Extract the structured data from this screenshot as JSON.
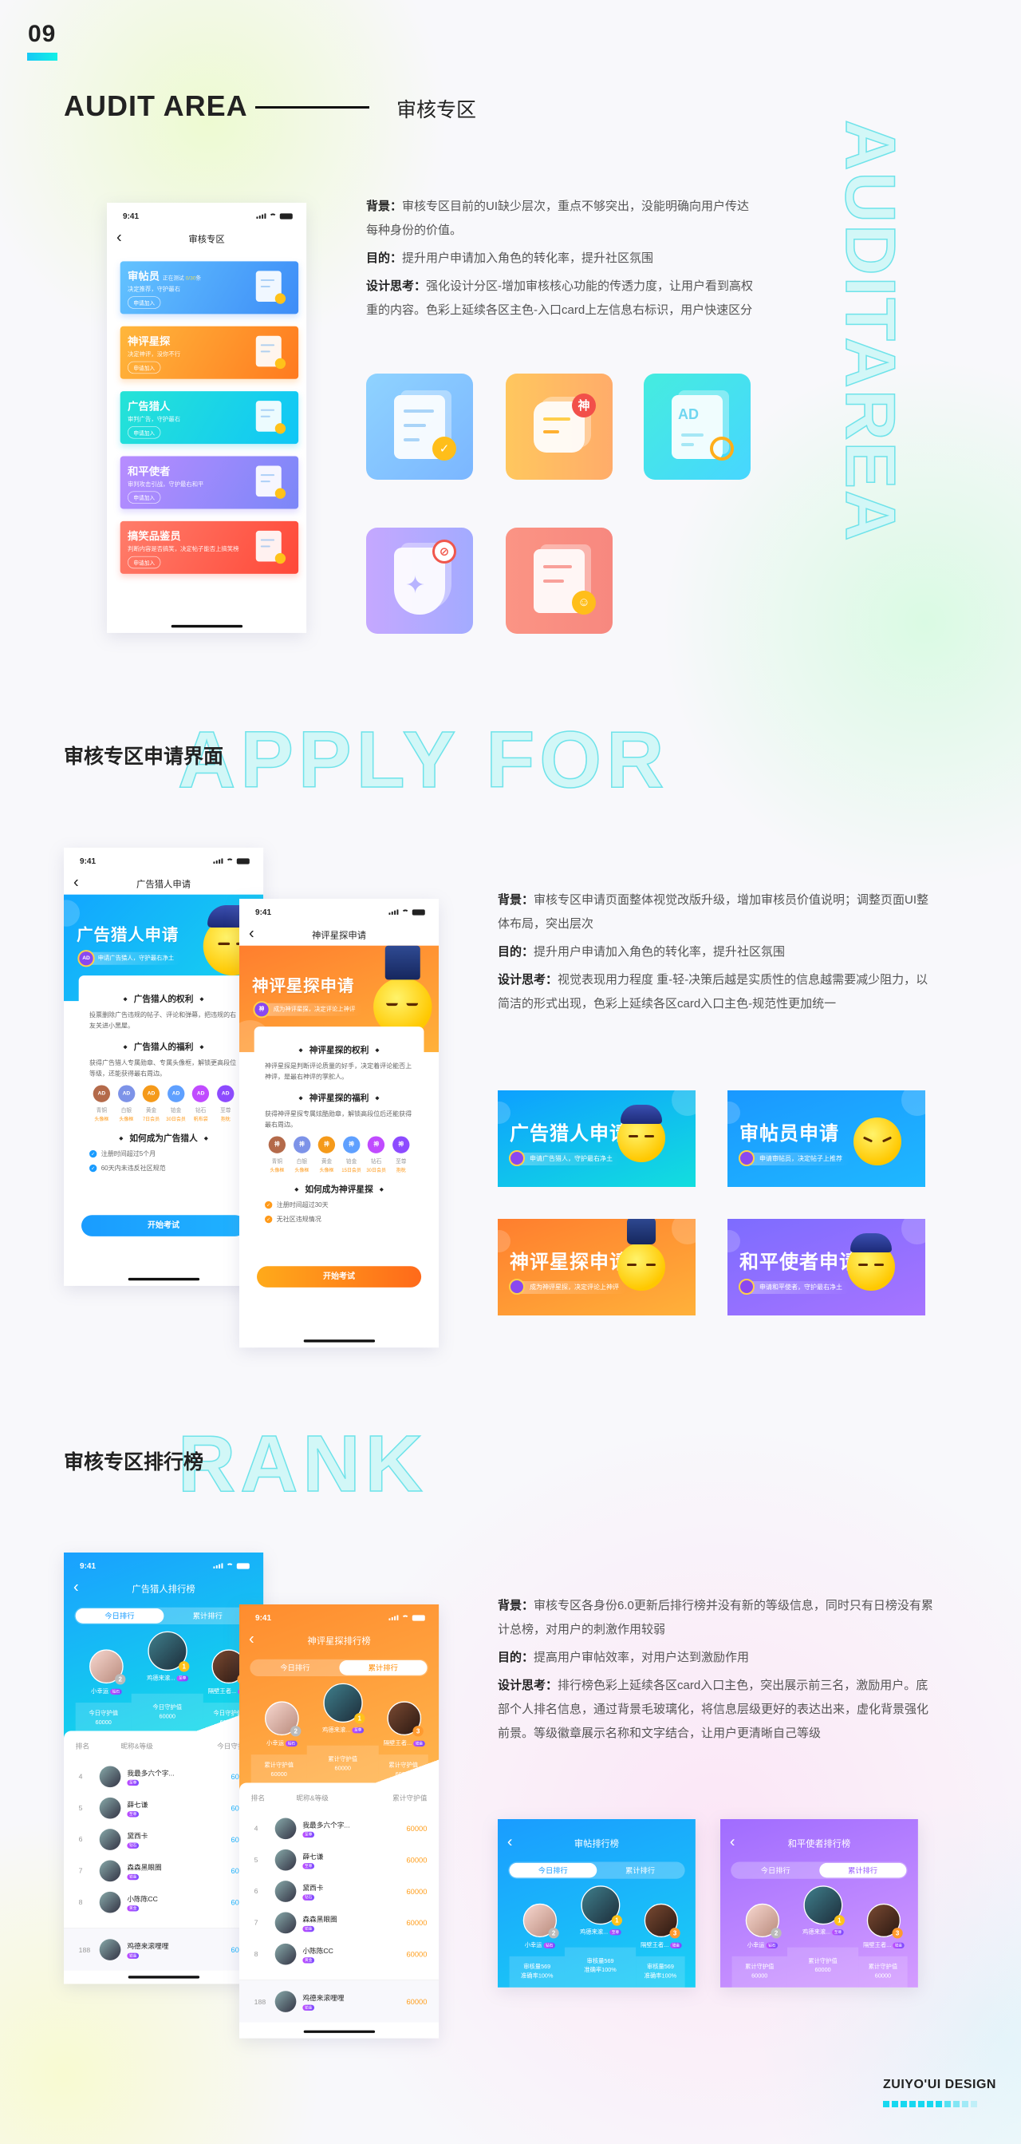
{
  "section_number": "09",
  "audit": {
    "title_en": "AUDIT AREA",
    "title_cn": "审核专区",
    "watermark": "AUDITAREA",
    "description": [
      {
        "label": "背景：",
        "text": "审核专区目前的UI缺少层次，重点不够突出，没能明确向用户传达每种身份的价值。"
      },
      {
        "label": "目的：",
        "text": "提升用户申请加入角色的转化率，提升社区氛围"
      },
      {
        "label": "设计思考：",
        "text": "强化设计分区-增加审核核心功能的传透力度，让用户看到高权重的内容。色彩上延续各区主色-入口card上左信息右标识，用户快速区分"
      }
    ],
    "icons": [
      {
        "name": "clipboard-check-icon",
        "badge": "✓",
        "color": "#7fc3ff"
      },
      {
        "name": "god-comment-icon",
        "badge": "神",
        "color": "#ffb766"
      },
      {
        "name": "ad-search-icon",
        "badge": "AD",
        "color": "#3de0ea"
      },
      {
        "name": "peace-shield-icon",
        "badge": "⊘",
        "color": "#a9a8ff"
      },
      {
        "name": "funny-doc-icon",
        "badge": "☺",
        "color": "#fb8b80"
      }
    ],
    "phone": {
      "time": "9:41",
      "title": "审核专区",
      "cards": [
        {
          "title": "审帖员",
          "status_label": "正在测试",
          "status_value": "0/30",
          "status_unit": "条",
          "subtitle": "决定推荐，守护最右",
          "button": "申请加入"
        },
        {
          "title": "神评星探",
          "subtitle": "决定神评，没你不行",
          "button": "申请加入"
        },
        {
          "title": "广告猎人",
          "subtitle": "审判广告，守护最右",
          "button": "申请加入"
        },
        {
          "title": "和平使者",
          "subtitle": "审判攻击引战，守护最右和平",
          "button": "申请加入"
        },
        {
          "title": "搞笑品鉴员",
          "subtitle": "判断内容是否搞笑，决定帖子能否上搞笑榜",
          "button": "申请加入"
        }
      ]
    }
  },
  "apply": {
    "heading": "审核专区申请界面",
    "watermark": "APPLY FOR",
    "description": [
      {
        "label": "背景：",
        "text": "审核专区申请页面整体视觉改版升级，增加审核员价值说明；调整页面UI整体布局，突出层次"
      },
      {
        "label": "目的：",
        "text": "提升用户申请加入角色的转化率，提升社区氛围"
      },
      {
        "label": "设计思考：",
        "text": "视觉表现用力程度 重-轻-决策后越是实质性的信息越需要减少阻力，以简洁的形式出现，色彩上延续各区card入口主色-规范性更加统一"
      }
    ],
    "phones": [
      {
        "time": "9:41",
        "nav_title": "广告猎人申请",
        "banner_title": "广告猎人申请",
        "banner_badge": "AD",
        "banner_sub": "申请广告猎人，守护最右净土",
        "rights_title": "广告猎人的权利",
        "rights_text": "投票删除广告违规的帖子、评论和弹幕，把违规的右友关进小黑屋。",
        "benefits_title": "广告猎人的福利",
        "benefits_text": "获得广告猎人专属勋章、专属头像框，解锁更高段位等级，还能获得最右周边。",
        "levels": [
          {
            "badge": "AD",
            "name": "青铜",
            "reward": "头像框"
          },
          {
            "badge": "AD",
            "name": "白银",
            "reward": "头像框"
          },
          {
            "badge": "AD",
            "name": "黄金",
            "reward": "7日会员"
          },
          {
            "badge": "AD",
            "name": "铂金",
            "reward": "30日会员"
          },
          {
            "badge": "AD",
            "name": "钻石",
            "reward": "帆布袋"
          },
          {
            "badge": "AD",
            "name": "至尊",
            "reward": "抱枕"
          }
        ],
        "how_title": "如何成为广告猎人",
        "requirements": [
          "注册时间超过5个月",
          "60天内未违反社区规范"
        ],
        "button": "开始考试"
      },
      {
        "time": "9:41",
        "nav_title": "神评星探申请",
        "banner_title": "神评星探申请",
        "banner_badge": "神",
        "banner_sub": "成为神评星探，决定评论上神评",
        "rights_title": "神评星探的权利",
        "rights_text": "神评星探是判断评论质量的好手，决定着评论能否上神评，是最右神评的掌舵人。",
        "benefits_title": "神评星探的福利",
        "benefits_text": "获得神评星探专属炫酷勋章，解锁高段位后还能获得最右周边。",
        "levels": [
          {
            "badge": "神",
            "name": "青铜",
            "reward": "头像框"
          },
          {
            "badge": "神",
            "name": "白银",
            "reward": "头像框"
          },
          {
            "badge": "神",
            "name": "黄金",
            "reward": "头像框"
          },
          {
            "badge": "神",
            "name": "铂金",
            "reward": "15日会员"
          },
          {
            "badge": "神",
            "name": "钻石",
            "reward": "30日会员"
          },
          {
            "badge": "神",
            "name": "至尊",
            "reward": "抱枕"
          }
        ],
        "how_title": "如何成为神评星探",
        "requirements": [
          "注册时间超过30天",
          "无社区违规情况"
        ],
        "button": "开始考试"
      }
    ],
    "banners": [
      {
        "title": "广告猎人申请",
        "subtitle": "申请广告猎人，守护最右净土",
        "color": "#12b8f0"
      },
      {
        "title": "审帖员申请",
        "subtitle": "申请审帖员，决定帖子上推荐",
        "color": "#1aa6ff"
      },
      {
        "title": "神评星探申请",
        "subtitle": "成为神评星探，决定评论上神评",
        "color": "#ff8c2e"
      },
      {
        "title": "和平使者申请",
        "subtitle": "申请和平使者，守护最右净土",
        "color": "#8f76ff"
      }
    ]
  },
  "rank": {
    "heading": "审核专区排行榜",
    "watermark": "RANK",
    "description": [
      {
        "label": "背景：",
        "text": "审核专区各身份6.0更新后排行榜并没有新的等级信息，同时只有日榜没有累计总榜，对用户的刺激作用较弱"
      },
      {
        "label": "目的：",
        "text": "提高用户审帖效率，对用户达到激励作用"
      },
      {
        "label": "设计思考：",
        "text": "排行榜色彩上延续各区card入口主色，突出展示前三名，激励用户。底部个人排名信息，通过背景毛玻璃化，将信息层级更好的表达出来，虚化背景强化前景。等级徽章展示名称和文字结合，让用户更清晰自己等级"
      }
    ],
    "screens": [
      {
        "time": "9:41",
        "title": "广告猎人排行榜",
        "tabs": [
          "今日排行",
          "累计排行"
        ],
        "active_tab": "今日排行",
        "top3": [
          {
            "name": "小幸运",
            "rank": "2",
            "level": "钻石"
          },
          {
            "name": "鸡德来滚...",
            "rank": "1",
            "level": "至尊"
          },
          {
            "name": "隔壁王者...",
            "rank": "3",
            "level": "铂金"
          }
        ],
        "podium": [
          {
            "label": "今日守护值",
            "value": "60000"
          },
          {
            "label": "今日守护值",
            "value": "60000"
          },
          {
            "label": "今日守护值",
            "value": "60000"
          }
        ],
        "columns": [
          "排名",
          "昵称&等级",
          "今日守护值"
        ],
        "list": [
          {
            "rank": "4",
            "name": "我最多六个字...",
            "level": "至尊",
            "value": "60000"
          },
          {
            "rank": "5",
            "name": "薛七谦",
            "level": "至尊",
            "value": "60000"
          },
          {
            "rank": "6",
            "name": "黛西卡",
            "level": "钻石",
            "value": "60000"
          },
          {
            "rank": "7",
            "name": "森森黑眼圈",
            "level": "铂金",
            "value": "60000"
          },
          {
            "rank": "8",
            "name": "小陈陈CC",
            "level": "黄金",
            "value": "60000"
          }
        ],
        "me": {
          "rank": "188",
          "name": "鸡德来滚哩哩",
          "level": "铂金",
          "value": "60000"
        }
      },
      {
        "time": "9:41",
        "title": "神评星探排行榜",
        "tabs": [
          "今日排行",
          "累计排行"
        ],
        "active_tab": "累计排行",
        "top3": [
          {
            "name": "小幸运",
            "rank": "2",
            "level": "钻石"
          },
          {
            "name": "鸡德来滚...",
            "rank": "1",
            "level": "至尊"
          },
          {
            "name": "隔壁王者...",
            "rank": "3",
            "level": "铂金"
          }
        ],
        "podium": [
          {
            "label": "累计守护值",
            "value": "60000"
          },
          {
            "label": "累计守护值",
            "value": "60000"
          },
          {
            "label": "累计守护值",
            "value": "60000"
          }
        ],
        "columns": [
          "排名",
          "昵称&等级",
          "累计守护值"
        ],
        "list": [
          {
            "rank": "4",
            "name": "我最多六个字...",
            "level": "至尊",
            "value": "60000"
          },
          {
            "rank": "5",
            "name": "薛七谦",
            "level": "至尊",
            "value": "60000"
          },
          {
            "rank": "6",
            "name": "黛西卡",
            "level": "钻石",
            "value": "60000"
          },
          {
            "rank": "7",
            "name": "森森黑眼圈",
            "level": "铂金",
            "value": "60000"
          },
          {
            "rank": "8",
            "name": "小陈陈CC",
            "level": "黄金",
            "value": "60000"
          }
        ],
        "me": {
          "rank": "188",
          "name": "鸡德来滚哩哩",
          "level": "铂金",
          "value": "60000"
        }
      },
      {
        "title": "审帖排行榜",
        "tabs": [
          "今日排行",
          "累计排行"
        ],
        "active_tab": "今日排行",
        "top3": [
          {
            "name": "小幸运",
            "rank": "2",
            "level": "钻石"
          },
          {
            "name": "鸡德来滚...",
            "rank": "1",
            "level": "至尊"
          },
          {
            "name": "隔壁王者...",
            "rank": "3",
            "level": "铂金"
          }
        ],
        "podium": [
          {
            "label": "审核量569",
            "value": "准确率100%"
          },
          {
            "label": "审核量569",
            "value": "准确率100%"
          },
          {
            "label": "审核量569",
            "value": "准确率100%"
          }
        ]
      },
      {
        "title": "和平使者排行榜",
        "tabs": [
          "今日排行",
          "累计排行"
        ],
        "active_tab": "累计排行",
        "top3": [
          {
            "name": "小幸运",
            "rank": "2",
            "level": "钻石"
          },
          {
            "name": "鸡德来滚...",
            "rank": "1",
            "level": "至尊"
          },
          {
            "name": "隔壁王者...",
            "rank": "3",
            "level": "铂金"
          }
        ],
        "podium": [
          {
            "label": "累计守护值",
            "value": "60000"
          },
          {
            "label": "累计守护值",
            "value": "60000"
          },
          {
            "label": "累计守护值",
            "value": "60000"
          }
        ]
      }
    ]
  },
  "footer": {
    "brand": "ZUIYO'UI DESIGN"
  },
  "colors": {
    "accent": "#17d8f0",
    "blue": "#1aa7ff",
    "orange": "#ff8c2e",
    "purple": "#a87cff"
  }
}
